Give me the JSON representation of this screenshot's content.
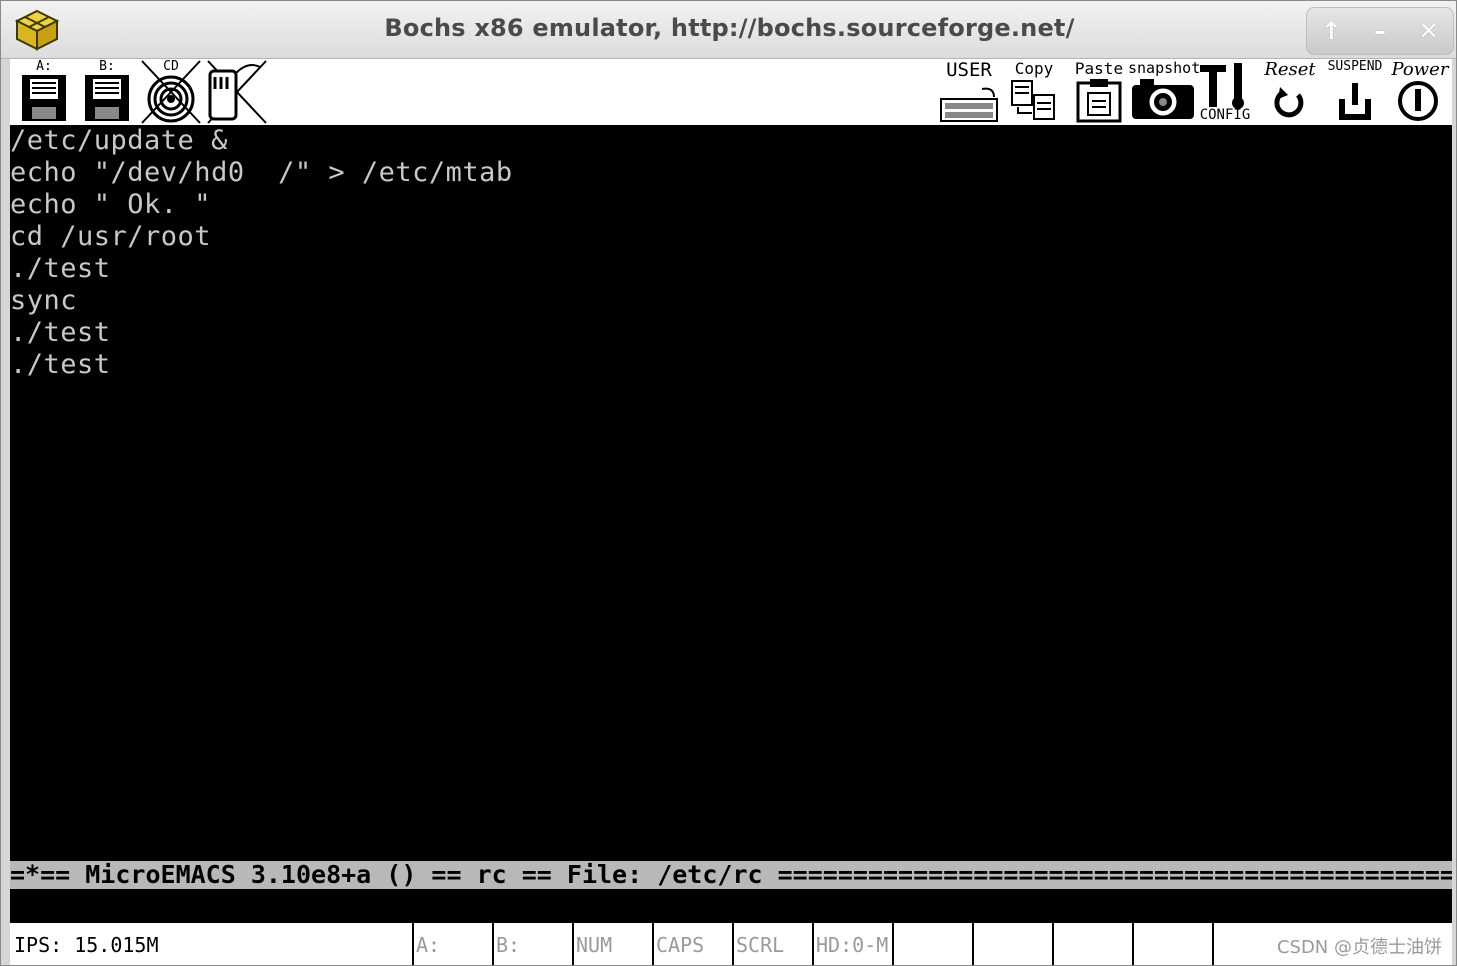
{
  "window": {
    "title": "Bochs x86 emulator, http://bochs.sourceforge.net/",
    "controls": {
      "maximize": "↑",
      "minimize": "–",
      "close": "✕"
    }
  },
  "toolbar": {
    "floppy_a": "A:",
    "floppy_b": "B:",
    "cdrom": "CD",
    "user": "USER",
    "copy": "Copy",
    "paste": "Paste",
    "snapshot": "snapshot",
    "config": "CONFIG",
    "reset": "Reset",
    "suspend": "SUSPEND",
    "power": "Power"
  },
  "console": {
    "lines": [
      "/etc/update &",
      "echo \"/dev/hd0  /\" > /etc/mtab",
      "echo \" Ok. \"",
      "cd /usr/root",
      "./test",
      "sync",
      "./test",
      "./test"
    ],
    "modeline": "=*== MicroEMACS 3.10e8+a () == rc == File: /etc/rc ==============================================="
  },
  "statusbar": {
    "ips": "IPS: 15.015M",
    "a": "A:",
    "b": "B:",
    "num": "NUM",
    "caps": "CAPS",
    "scrl": "SCRL",
    "hd": "HD:0-M"
  },
  "watermark": "CSDN @贞德士油饼"
}
